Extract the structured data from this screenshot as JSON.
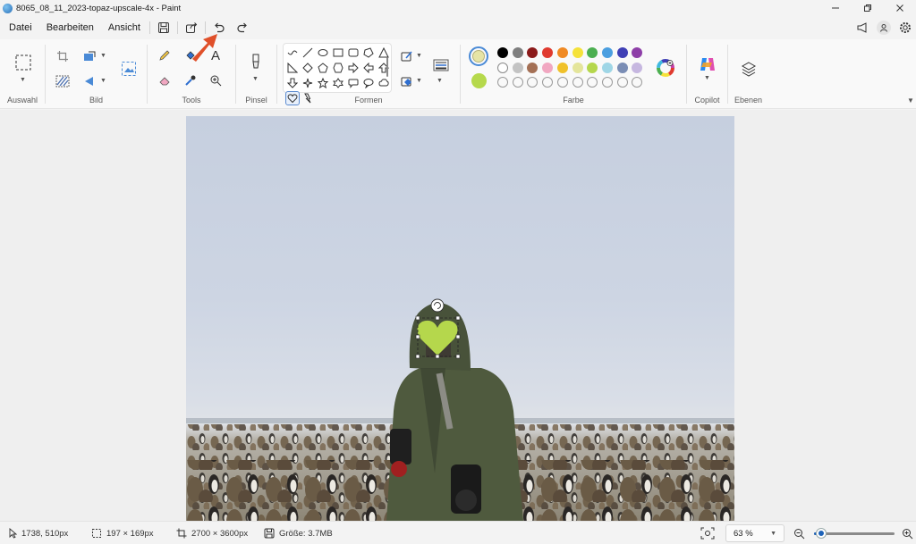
{
  "window": {
    "title": "8065_08_11_2023-topaz-upscale-4x - Paint"
  },
  "menu": {
    "file": "Datei",
    "edit": "Bearbeiten",
    "view": "Ansicht"
  },
  "ribbon": {
    "groups": {
      "selection": "Auswahl",
      "image": "Bild",
      "tools": "Tools",
      "brush": "Pinsel",
      "shapes": "Formen",
      "color": "Farbe",
      "copilot": "Copilot",
      "layers": "Ebenen"
    },
    "text_tool_glyph": "A",
    "colors": {
      "primary": "#e6e4a6",
      "secondary": "#b6d94c",
      "palette_row1": [
        "#000000",
        "#7f7f7f",
        "#8b1a1a",
        "#e03a2f",
        "#f08a24",
        "#f5e23a",
        "#4caf50",
        "#4b9fe0",
        "#3f3fb5",
        "#8e3fa8"
      ],
      "palette_row2": [
        "#ffffff",
        "#c3c3c3",
        "#a47055",
        "#f1a7c1",
        "#f0c12a",
        "#e4e59b",
        "#b5d74c",
        "#9fd6e6",
        "#7a8db5",
        "#c6b7e0"
      ]
    }
  },
  "status": {
    "cursor_position": "1738, 510px",
    "selection_size": "197 × 169px",
    "canvas_size": "2700 × 3600px",
    "file_size": "Größe: 3.7MB",
    "zoom_level": "63 %",
    "zoom_fraction": 0.09
  },
  "annotation": {
    "arrow_color": "#e0502a"
  }
}
